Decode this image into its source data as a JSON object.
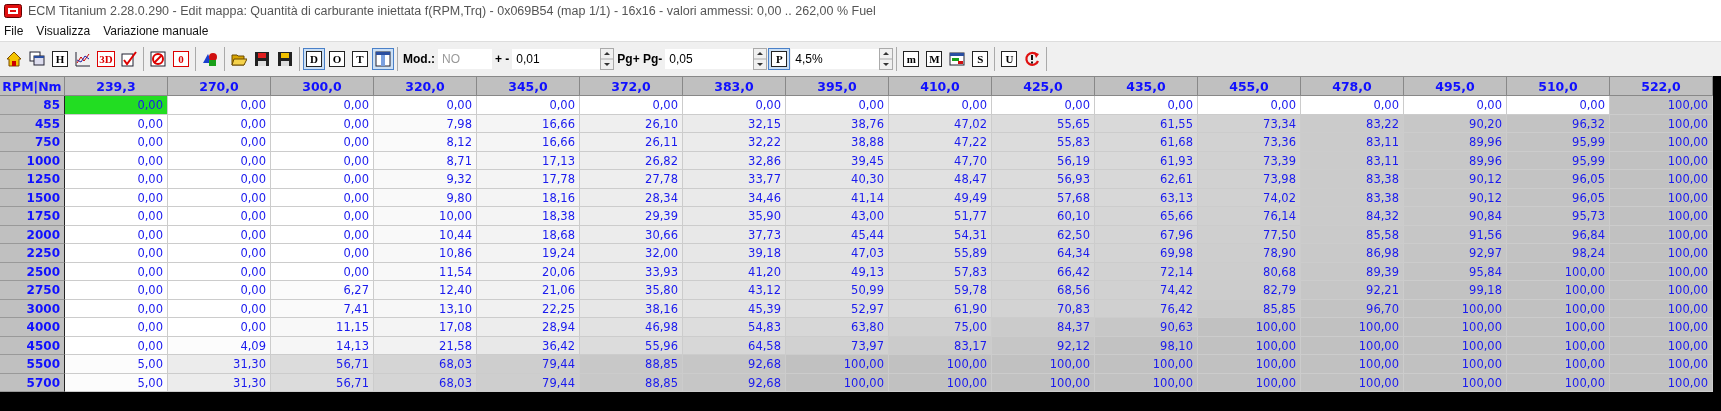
{
  "window": {
    "title": "ECM Titanium 2.28.0.290 - Edit mappa: Quantità di carburante iniettata f(RPM,Trq) - 0x069B54 (map 1/1) - 16x16 - valori ammessi: 0,00 .. 262,00 % Fuel"
  },
  "menu": [
    "File",
    "Visualizza",
    "Variazione manuale"
  ],
  "toolbar": [
    [
      {
        "kind": "home",
        "selected": false
      },
      {
        "kind": "windows",
        "selected": false
      },
      {
        "kind": "letter",
        "label": "H",
        "selected": false
      },
      {
        "kind": "chart",
        "selected": false
      },
      {
        "kind": "letter-red",
        "label": "3D",
        "selected": false
      },
      {
        "kind": "check",
        "selected": false
      }
    ],
    [
      {
        "kind": "forbid",
        "selected": false
      },
      {
        "kind": "letter-red",
        "label": "0",
        "selected": false
      }
    ],
    [
      {
        "kind": "shapes",
        "selected": false
      }
    ],
    [
      {
        "kind": "folder",
        "selected": false
      },
      {
        "kind": "save-red",
        "selected": false
      },
      {
        "kind": "save",
        "selected": false
      }
    ],
    [
      {
        "kind": "letter",
        "label": "D",
        "selected": true
      },
      {
        "kind": "letter",
        "label": "O",
        "selected": false
      },
      {
        "kind": "letter",
        "label": "T",
        "selected": false
      },
      {
        "kind": "column",
        "selected": true
      }
    ],
    [
      {
        "kind": "text",
        "label": "Mod.:"
      },
      {
        "kind": "field",
        "value": "NO",
        "disabled": true
      },
      {
        "kind": "text",
        "label": "+ -"
      },
      {
        "kind": "spin",
        "value": "0,01"
      },
      {
        "kind": "text",
        "label": "Pg+ Pg-"
      },
      {
        "kind": "spin",
        "value": "0,05"
      },
      {
        "kind": "letter",
        "label": "P",
        "selected": true
      },
      {
        "kind": "spin",
        "value": "4,5%"
      }
    ],
    [
      {
        "kind": "letter",
        "label": "m",
        "selected": false
      },
      {
        "kind": "letter",
        "label": "M",
        "selected": false
      },
      {
        "kind": "card",
        "selected": false
      },
      {
        "kind": "letter",
        "label": "S",
        "selected": false
      }
    ],
    [
      {
        "kind": "letter",
        "label": "U",
        "selected": false
      },
      {
        "kind": "refresh",
        "selected": false
      }
    ]
  ],
  "table": {
    "corner": "RPM|Nm",
    "columns": [
      "239,3",
      "270,0",
      "300,0",
      "320,0",
      "345,0",
      "372,0",
      "383,0",
      "395,0",
      "410,0",
      "425,0",
      "435,0",
      "455,0",
      "478,0",
      "495,0",
      "510,0",
      "522,0"
    ],
    "rows": [
      {
        "rpm": "85",
        "cells": [
          {
            "value": "0,00",
            "selected": true
          },
          {
            "value": "0,00",
            "selected": false
          },
          {
            "value": "0,00",
            "selected": false
          },
          {
            "value": "0,00",
            "selected": false
          },
          {
            "value": "0,00",
            "selected": false
          },
          {
            "value": "0,00",
            "selected": false
          },
          {
            "value": "0,00",
            "selected": false
          },
          {
            "value": "0,00",
            "selected": false
          },
          {
            "value": "0,00",
            "selected": false
          },
          {
            "value": "0,00",
            "selected": false
          },
          {
            "value": "0,00",
            "selected": false
          },
          {
            "value": "0,00",
            "selected": false
          },
          {
            "value": "0,00",
            "selected": false
          },
          {
            "value": "0,00",
            "selected": false
          },
          {
            "value": "0,00",
            "selected": false
          },
          {
            "value": "100,00",
            "selected": false
          }
        ]
      },
      {
        "rpm": "455",
        "cells": [
          {
            "value": "0,00",
            "selected": false
          },
          {
            "value": "0,00",
            "selected": false
          },
          {
            "value": "0,00",
            "selected": false
          },
          {
            "value": "7,98",
            "selected": false
          },
          {
            "value": "16,66",
            "selected": false
          },
          {
            "value": "26,10",
            "selected": false
          },
          {
            "value": "32,15",
            "selected": false
          },
          {
            "value": "38,76",
            "selected": false
          },
          {
            "value": "47,02",
            "selected": false
          },
          {
            "value": "55,65",
            "selected": false
          },
          {
            "value": "61,55",
            "selected": false
          },
          {
            "value": "73,34",
            "selected": false
          },
          {
            "value": "83,22",
            "selected": false
          },
          {
            "value": "90,20",
            "selected": false
          },
          {
            "value": "96,32",
            "selected": false
          },
          {
            "value": "100,00",
            "selected": false
          }
        ]
      },
      {
        "rpm": "750",
        "cells": [
          {
            "value": "0,00",
            "selected": false
          },
          {
            "value": "0,00",
            "selected": false
          },
          {
            "value": "0,00",
            "selected": false
          },
          {
            "value": "8,12",
            "selected": false
          },
          {
            "value": "16,66",
            "selected": false
          },
          {
            "value": "26,11",
            "selected": false
          },
          {
            "value": "32,22",
            "selected": false
          },
          {
            "value": "38,88",
            "selected": false
          },
          {
            "value": "47,22",
            "selected": false
          },
          {
            "value": "55,83",
            "selected": false
          },
          {
            "value": "61,68",
            "selected": false
          },
          {
            "value": "73,36",
            "selected": false
          },
          {
            "value": "83,11",
            "selected": false
          },
          {
            "value": "89,96",
            "selected": false
          },
          {
            "value": "95,99",
            "selected": false
          },
          {
            "value": "100,00",
            "selected": false
          }
        ]
      },
      {
        "rpm": "1000",
        "cells": [
          {
            "value": "0,00",
            "selected": false
          },
          {
            "value": "0,00",
            "selected": false
          },
          {
            "value": "0,00",
            "selected": false
          },
          {
            "value": "8,71",
            "selected": false
          },
          {
            "value": "17,13",
            "selected": false
          },
          {
            "value": "26,82",
            "selected": false
          },
          {
            "value": "32,86",
            "selected": false
          },
          {
            "value": "39,45",
            "selected": false
          },
          {
            "value": "47,70",
            "selected": false
          },
          {
            "value": "56,19",
            "selected": false
          },
          {
            "value": "61,93",
            "selected": false
          },
          {
            "value": "73,39",
            "selected": false
          },
          {
            "value": "83,11",
            "selected": false
          },
          {
            "value": "89,96",
            "selected": false
          },
          {
            "value": "95,99",
            "selected": false
          },
          {
            "value": "100,00",
            "selected": false
          }
        ]
      },
      {
        "rpm": "1250",
        "cells": [
          {
            "value": "0,00",
            "selected": false
          },
          {
            "value": "0,00",
            "selected": false
          },
          {
            "value": "0,00",
            "selected": false
          },
          {
            "value": "9,32",
            "selected": false
          },
          {
            "value": "17,78",
            "selected": false
          },
          {
            "value": "27,78",
            "selected": false
          },
          {
            "value": "33,77",
            "selected": false
          },
          {
            "value": "40,30",
            "selected": false
          },
          {
            "value": "48,47",
            "selected": false
          },
          {
            "value": "56,93",
            "selected": false
          },
          {
            "value": "62,61",
            "selected": false
          },
          {
            "value": "73,98",
            "selected": false
          },
          {
            "value": "83,38",
            "selected": false
          },
          {
            "value": "90,12",
            "selected": false
          },
          {
            "value": "96,05",
            "selected": false
          },
          {
            "value": "100,00",
            "selected": false
          }
        ]
      },
      {
        "rpm": "1500",
        "cells": [
          {
            "value": "0,00",
            "selected": false
          },
          {
            "value": "0,00",
            "selected": false
          },
          {
            "value": "0,00",
            "selected": false
          },
          {
            "value": "9,80",
            "selected": false
          },
          {
            "value": "18,16",
            "selected": false
          },
          {
            "value": "28,34",
            "selected": false
          },
          {
            "value": "34,46",
            "selected": false
          },
          {
            "value": "41,14",
            "selected": false
          },
          {
            "value": "49,49",
            "selected": false
          },
          {
            "value": "57,68",
            "selected": false
          },
          {
            "value": "63,13",
            "selected": false
          },
          {
            "value": "74,02",
            "selected": false
          },
          {
            "value": "83,38",
            "selected": false
          },
          {
            "value": "90,12",
            "selected": false
          },
          {
            "value": "96,05",
            "selected": false
          },
          {
            "value": "100,00",
            "selected": false
          }
        ]
      },
      {
        "rpm": "1750",
        "cells": [
          {
            "value": "0,00",
            "selected": false
          },
          {
            "value": "0,00",
            "selected": false
          },
          {
            "value": "0,00",
            "selected": false
          },
          {
            "value": "10,00",
            "selected": false
          },
          {
            "value": "18,38",
            "selected": false
          },
          {
            "value": "29,39",
            "selected": false
          },
          {
            "value": "35,90",
            "selected": false
          },
          {
            "value": "43,00",
            "selected": false
          },
          {
            "value": "51,77",
            "selected": false
          },
          {
            "value": "60,10",
            "selected": false
          },
          {
            "value": "65,66",
            "selected": false
          },
          {
            "value": "76,14",
            "selected": false
          },
          {
            "value": "84,32",
            "selected": false
          },
          {
            "value": "90,84",
            "selected": false
          },
          {
            "value": "95,73",
            "selected": false
          },
          {
            "value": "100,00",
            "selected": false
          }
        ]
      },
      {
        "rpm": "2000",
        "cells": [
          {
            "value": "0,00",
            "selected": false
          },
          {
            "value": "0,00",
            "selected": false
          },
          {
            "value": "0,00",
            "selected": false
          },
          {
            "value": "10,44",
            "selected": false
          },
          {
            "value": "18,68",
            "selected": false
          },
          {
            "value": "30,66",
            "selected": false
          },
          {
            "value": "37,73",
            "selected": false
          },
          {
            "value": "45,44",
            "selected": false
          },
          {
            "value": "54,31",
            "selected": false
          },
          {
            "value": "62,50",
            "selected": false
          },
          {
            "value": "67,96",
            "selected": false
          },
          {
            "value": "77,50",
            "selected": false
          },
          {
            "value": "85,58",
            "selected": false
          },
          {
            "value": "91,56",
            "selected": false
          },
          {
            "value": "96,84",
            "selected": false
          },
          {
            "value": "100,00",
            "selected": false
          }
        ]
      },
      {
        "rpm": "2250",
        "cells": [
          {
            "value": "0,00",
            "selected": false
          },
          {
            "value": "0,00",
            "selected": false
          },
          {
            "value": "0,00",
            "selected": false
          },
          {
            "value": "10,86",
            "selected": false
          },
          {
            "value": "19,24",
            "selected": false
          },
          {
            "value": "32,00",
            "selected": false
          },
          {
            "value": "39,18",
            "selected": false
          },
          {
            "value": "47,03",
            "selected": false
          },
          {
            "value": "55,89",
            "selected": false
          },
          {
            "value": "64,34",
            "selected": false
          },
          {
            "value": "69,98",
            "selected": false
          },
          {
            "value": "78,90",
            "selected": false
          },
          {
            "value": "86,98",
            "selected": false
          },
          {
            "value": "92,97",
            "selected": false
          },
          {
            "value": "98,24",
            "selected": false
          },
          {
            "value": "100,00",
            "selected": false
          }
        ]
      },
      {
        "rpm": "2500",
        "cells": [
          {
            "value": "0,00",
            "selected": false
          },
          {
            "value": "0,00",
            "selected": false
          },
          {
            "value": "0,00",
            "selected": false
          },
          {
            "value": "11,54",
            "selected": false
          },
          {
            "value": "20,06",
            "selected": false
          },
          {
            "value": "33,93",
            "selected": false
          },
          {
            "value": "41,20",
            "selected": false
          },
          {
            "value": "49,13",
            "selected": false
          },
          {
            "value": "57,83",
            "selected": false
          },
          {
            "value": "66,42",
            "selected": false
          },
          {
            "value": "72,14",
            "selected": false
          },
          {
            "value": "80,68",
            "selected": false
          },
          {
            "value": "89,39",
            "selected": false
          },
          {
            "value": "95,84",
            "selected": false
          },
          {
            "value": "100,00",
            "selected": false
          },
          {
            "value": "100,00",
            "selected": false
          }
        ]
      },
      {
        "rpm": "2750",
        "cells": [
          {
            "value": "0,00",
            "selected": false
          },
          {
            "value": "0,00",
            "selected": false
          },
          {
            "value": "6,27",
            "selected": false
          },
          {
            "value": "12,40",
            "selected": false
          },
          {
            "value": "21,06",
            "selected": false
          },
          {
            "value": "35,80",
            "selected": false
          },
          {
            "value": "43,12",
            "selected": false
          },
          {
            "value": "50,99",
            "selected": false
          },
          {
            "value": "59,78",
            "selected": false
          },
          {
            "value": "68,56",
            "selected": false
          },
          {
            "value": "74,42",
            "selected": false
          },
          {
            "value": "82,79",
            "selected": false
          },
          {
            "value": "92,21",
            "selected": false
          },
          {
            "value": "99,18",
            "selected": false
          },
          {
            "value": "100,00",
            "selected": false
          },
          {
            "value": "100,00",
            "selected": false
          }
        ]
      },
      {
        "rpm": "3000",
        "cells": [
          {
            "value": "0,00",
            "selected": false
          },
          {
            "value": "0,00",
            "selected": false
          },
          {
            "value": "7,41",
            "selected": false
          },
          {
            "value": "13,10",
            "selected": false
          },
          {
            "value": "22,25",
            "selected": false
          },
          {
            "value": "38,16",
            "selected": false
          },
          {
            "value": "45,39",
            "selected": false
          },
          {
            "value": "52,97",
            "selected": false
          },
          {
            "value": "61,90",
            "selected": false
          },
          {
            "value": "70,83",
            "selected": false
          },
          {
            "value": "76,42",
            "selected": false
          },
          {
            "value": "85,85",
            "selected": false
          },
          {
            "value": "96,70",
            "selected": false
          },
          {
            "value": "100,00",
            "selected": false
          },
          {
            "value": "100,00",
            "selected": false
          },
          {
            "value": "100,00",
            "selected": false
          }
        ]
      },
      {
        "rpm": "4000",
        "cells": [
          {
            "value": "0,00",
            "selected": false
          },
          {
            "value": "0,00",
            "selected": false
          },
          {
            "value": "11,15",
            "selected": false
          },
          {
            "value": "17,08",
            "selected": false
          },
          {
            "value": "28,94",
            "selected": false
          },
          {
            "value": "46,98",
            "selected": false
          },
          {
            "value": "54,83",
            "selected": false
          },
          {
            "value": "63,80",
            "selected": false
          },
          {
            "value": "75,00",
            "selected": false
          },
          {
            "value": "84,37",
            "selected": false
          },
          {
            "value": "90,63",
            "selected": false
          },
          {
            "value": "100,00",
            "selected": false
          },
          {
            "value": "100,00",
            "selected": false
          },
          {
            "value": "100,00",
            "selected": false
          },
          {
            "value": "100,00",
            "selected": false
          },
          {
            "value": "100,00",
            "selected": false
          }
        ]
      },
      {
        "rpm": "4500",
        "cells": [
          {
            "value": "0,00",
            "selected": false
          },
          {
            "value": "4,09",
            "selected": false
          },
          {
            "value": "14,13",
            "selected": false
          },
          {
            "value": "21,58",
            "selected": false
          },
          {
            "value": "36,42",
            "selected": false
          },
          {
            "value": "55,96",
            "selected": false
          },
          {
            "value": "64,58",
            "selected": false
          },
          {
            "value": "73,97",
            "selected": false
          },
          {
            "value": "83,17",
            "selected": false
          },
          {
            "value": "92,12",
            "selected": false
          },
          {
            "value": "98,10",
            "selected": false
          },
          {
            "value": "100,00",
            "selected": false
          },
          {
            "value": "100,00",
            "selected": false
          },
          {
            "value": "100,00",
            "selected": false
          },
          {
            "value": "100,00",
            "selected": false
          },
          {
            "value": "100,00",
            "selected": false
          }
        ]
      },
      {
        "rpm": "5500",
        "cells": [
          {
            "value": "5,00",
            "selected": false
          },
          {
            "value": "31,30",
            "selected": false
          },
          {
            "value": "56,71",
            "selected": false
          },
          {
            "value": "68,03",
            "selected": false
          },
          {
            "value": "79,44",
            "selected": false
          },
          {
            "value": "88,85",
            "selected": false
          },
          {
            "value": "92,68",
            "selected": false
          },
          {
            "value": "100,00",
            "selected": false
          },
          {
            "value": "100,00",
            "selected": false
          },
          {
            "value": "100,00",
            "selected": false
          },
          {
            "value": "100,00",
            "selected": false
          },
          {
            "value": "100,00",
            "selected": false
          },
          {
            "value": "100,00",
            "selected": false
          },
          {
            "value": "100,00",
            "selected": false
          },
          {
            "value": "100,00",
            "selected": false
          },
          {
            "value": "100,00",
            "selected": false
          }
        ]
      },
      {
        "rpm": "5700",
        "cells": [
          {
            "value": "5,00",
            "selected": false
          },
          {
            "value": "31,30",
            "selected": false
          },
          {
            "value": "56,71",
            "selected": false
          },
          {
            "value": "68,03",
            "selected": false
          },
          {
            "value": "79,44",
            "selected": false
          },
          {
            "value": "88,85",
            "selected": false
          },
          {
            "value": "92,68",
            "selected": false
          },
          {
            "value": "100,00",
            "selected": false
          },
          {
            "value": "100,00",
            "selected": false
          },
          {
            "value": "100,00",
            "selected": false
          },
          {
            "value": "100,00",
            "selected": false
          },
          {
            "value": "100,00",
            "selected": false
          },
          {
            "value": "100,00",
            "selected": false
          },
          {
            "value": "100,00",
            "selected": false
          },
          {
            "value": "100,00",
            "selected": false
          },
          {
            "value": "100,00",
            "selected": false
          }
        ]
      }
    ]
  }
}
